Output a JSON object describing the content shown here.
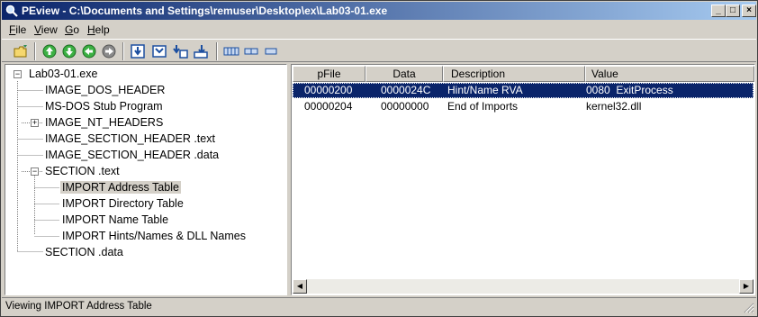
{
  "window": {
    "title": "PEview - C:\\Documents and Settings\\remuser\\Desktop\\ex\\Lab03-01.exe"
  },
  "titlebar_buttons": {
    "minimize": "_",
    "maximize": "□",
    "close": "×"
  },
  "menu": [
    {
      "label": "File",
      "accel": "F"
    },
    {
      "label": "View",
      "accel": "V"
    },
    {
      "label": "Go",
      "accel": "G"
    },
    {
      "label": "Help",
      "accel": "H"
    }
  ],
  "toolbar": {
    "icons": [
      "open-folder-icon",
      "back-up-icon",
      "forward-down-icon",
      "back-icon",
      "forward-icon",
      "hex-save-icon",
      "view-header-icon",
      "dword-icon",
      "word-icon",
      "byte-view-icon",
      "hex-view-icon",
      "text-view-icon"
    ]
  },
  "tree": [
    {
      "label": "Lab03-01.exe",
      "level": 0,
      "expander": "−"
    },
    {
      "label": "IMAGE_DOS_HEADER",
      "level": 1
    },
    {
      "label": "MS-DOS Stub Program",
      "level": 1
    },
    {
      "label": "IMAGE_NT_HEADERS",
      "level": 1,
      "expander": "+"
    },
    {
      "label": "IMAGE_SECTION_HEADER .text",
      "level": 1
    },
    {
      "label": "IMAGE_SECTION_HEADER .data",
      "level": 1
    },
    {
      "label": "SECTION .text",
      "level": 1,
      "expander": "−"
    },
    {
      "label": "IMPORT Address Table",
      "level": 2,
      "selected": true
    },
    {
      "label": "IMPORT Directory Table",
      "level": 2
    },
    {
      "label": "IMPORT Name Table",
      "level": 2
    },
    {
      "label": "IMPORT Hints/Names & DLL Names",
      "level": 2
    },
    {
      "label": "SECTION .data",
      "level": 1
    }
  ],
  "table": {
    "columns": [
      "pFile",
      "Data",
      "Description",
      "Value"
    ],
    "rows": [
      {
        "pFile": "00000200",
        "Data": "0000024C",
        "Description": "Hint/Name RVA",
        "Value": "0080  ExitProcess",
        "selected": true
      },
      {
        "pFile": "00000204",
        "Data": "00000000",
        "Description": "End of Imports",
        "Value": "kernel32.dll"
      }
    ]
  },
  "status": {
    "text": "Viewing IMPORT Address Table"
  },
  "colors": {
    "title_start": "#0a246a",
    "title_end": "#a6caf0",
    "selection": "#0a246a",
    "face": "#d4d0c8"
  }
}
